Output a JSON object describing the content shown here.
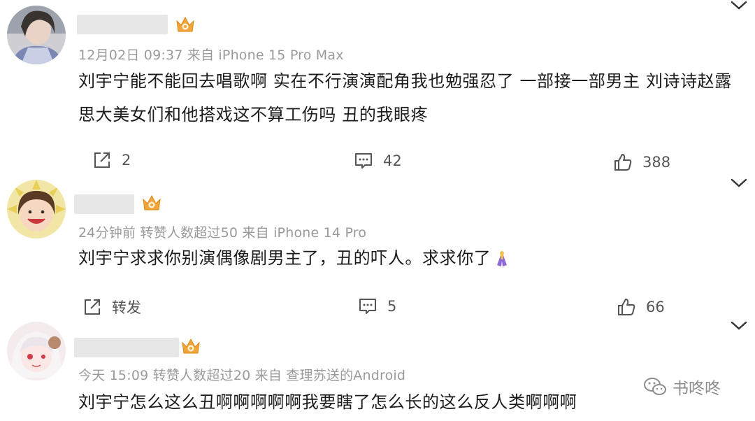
{
  "comments": [
    {
      "meta": "12月02日 09:37  来自 iPhone 15 Pro Max",
      "text_lines": [
        "刘宇宁能不能回去唱歌啊 实在不行演演配角我也勉强忍了 一部接一部男主 刘诗诗赵露",
        "思大美女们和他搭戏这不算工伤吗 丑的我眼疼"
      ],
      "actions": {
        "share": "2",
        "comment": "42",
        "like": "388"
      }
    },
    {
      "meta": "24分钟前  转赞人数超过50  来自 iPhone 14 Pro",
      "text": "刘宇宁求求你别演偶像剧男主了，丑的吓人。求求你了",
      "emoji": "pray-emoji",
      "actions": {
        "share": "转发",
        "comment": "5",
        "like": "66"
      }
    },
    {
      "meta": "今天 15:09  转赞人数超过20  来自  查理苏送的Android",
      "text": "刘宇宁怎么这么丑啊啊啊啊啊我要瞎了怎么长的这么反人类啊啊啊"
    }
  ],
  "watermark": {
    "label": "书咚咚",
    "icon": "wechat-icon"
  },
  "colors": {
    "badge": "#f2a53a",
    "meta": "#9a9a9a",
    "text": "#1b1b1b",
    "name_blur": "#e7e7e7"
  },
  "icons": [
    "share-icon",
    "comment-icon",
    "like-icon",
    "chevron-down-icon",
    "crown-badge-icon"
  ]
}
